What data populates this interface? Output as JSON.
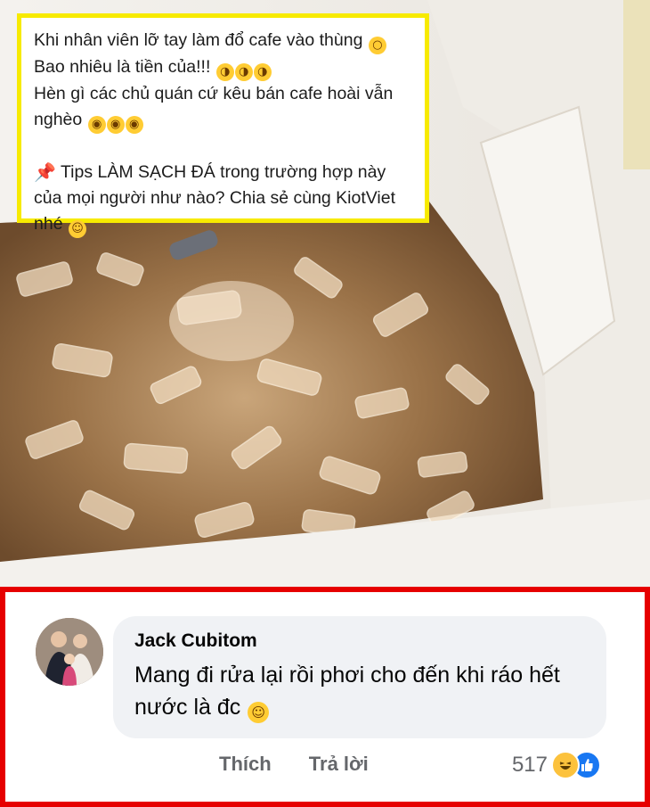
{
  "post": {
    "caption_lines": [
      "Khi nhân viên lỡ tay làm đổ cafe vào thùng",
      "Bao nhiêu là tiền của!!!",
      "Hèn gì các chủ quán cứ kêu bán cafe hoài vẫn",
      "nghèo"
    ],
    "tip_lines": [
      "Tips LÀM SẠCH ĐÁ trong trường hợp này",
      "của mọi người như nào? Chia sẻ cùng KiotViet",
      "nhé"
    ],
    "icons": {
      "shock": "screaming-face-emoji",
      "cry": "loudly-crying-face-emoji",
      "eyeroll": "rolling-eyes-emoji",
      "pin": "pushpin-emoji",
      "wink": "winking-face-emoji"
    },
    "accent_colors": {
      "caption_border": "#f7ea00",
      "comment_border": "#e60000"
    }
  },
  "comment": {
    "author": "Jack Cubitom",
    "text": "Mang đi rửa lại rồi phơi cho đến khi ráo hết nước là đc",
    "text_emoji": "rolling-on-floor-laughing-emoji",
    "actions": {
      "like_label": "Thích",
      "reply_label": "Trả lời"
    },
    "reaction_count": "517",
    "reaction_icons": [
      "haha-reaction-icon",
      "like-reaction-icon"
    ],
    "colors": {
      "bubble": "#f0f2f5",
      "meta_text": "#65676b",
      "like_blue": "#1877f2"
    }
  }
}
